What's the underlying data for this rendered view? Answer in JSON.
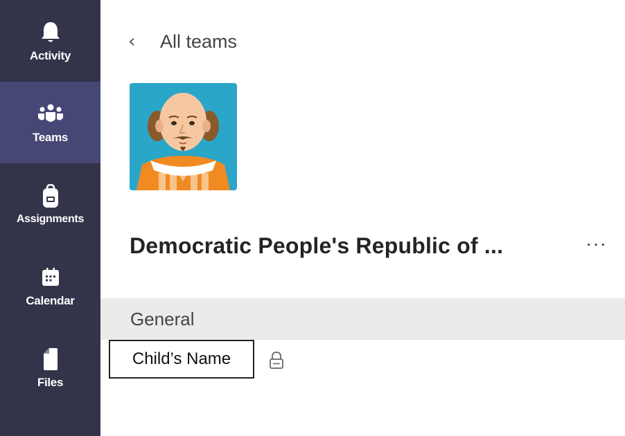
{
  "sidebar": {
    "items": [
      {
        "label": "Activity",
        "icon": "bell-icon"
      },
      {
        "label": "Teams",
        "icon": "teams-icon"
      },
      {
        "label": "Assignments",
        "icon": "backpack-icon"
      },
      {
        "label": "Calendar",
        "icon": "calendar-icon"
      },
      {
        "label": "Files",
        "icon": "file-icon"
      }
    ],
    "active": "Teams",
    "colors": {
      "background": "#33344a",
      "active_background": "#464775"
    }
  },
  "header": {
    "back_label": "All teams",
    "back_icon": "chevron-left-icon"
  },
  "team": {
    "name": "Democratic People's Republic of ...",
    "avatar": "shakespeare-avatar",
    "more_label": "···"
  },
  "channels": {
    "general": "General",
    "private": "Child’s Name",
    "private_icon": "lock-icon"
  }
}
